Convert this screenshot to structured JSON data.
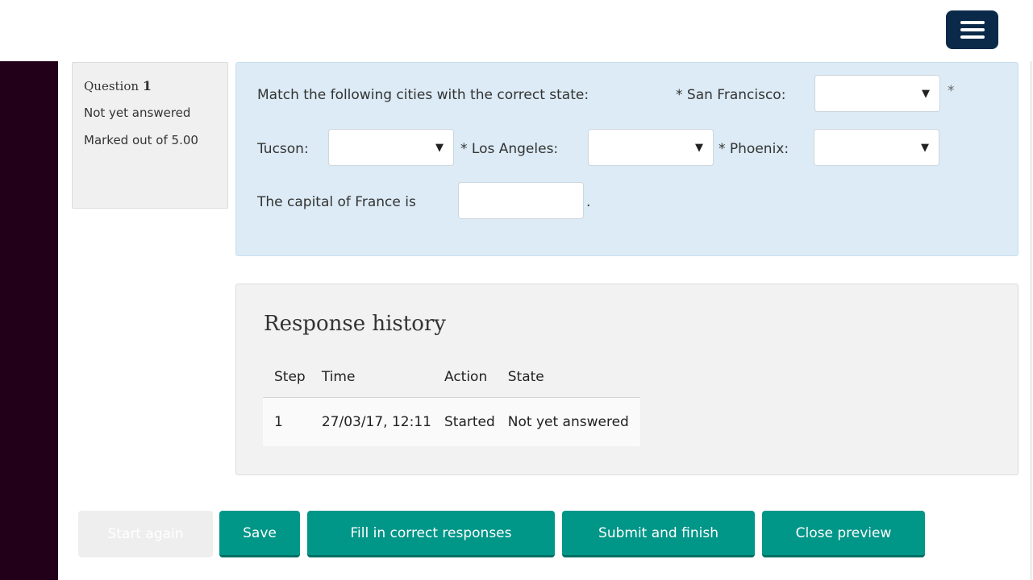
{
  "header": {
    "menu_icon": "hamburger-menu-icon"
  },
  "question_info": {
    "question_label": "Question",
    "question_number": "1",
    "status": "Not yet answered",
    "marked_out_of": "Marked out of 5.00"
  },
  "question": {
    "intro": "Match the following cities with the correct state:",
    "star": "*",
    "items": [
      {
        "label": "* San Francisco:",
        "selected": ""
      },
      {
        "label": "Tucson:",
        "selected": ""
      },
      {
        "label": "* Los Angeles:",
        "selected": ""
      },
      {
        "label": "* Phoenix:",
        "selected": ""
      }
    ],
    "caret": "▼",
    "fill_prefix": "The capital of France is",
    "fill_value": "",
    "fill_suffix": "."
  },
  "response_history": {
    "title": "Response history",
    "columns": [
      "Step",
      "Time",
      "Action",
      "State"
    ],
    "rows": [
      [
        "1",
        "27/03/17, 12:11",
        "Started",
        "Not yet answered"
      ]
    ]
  },
  "buttons": {
    "start_again": "Start again",
    "save": "Save",
    "fill_correct": "Fill in correct responses",
    "submit_finish": "Submit and finish",
    "close_preview": "Close preview"
  },
  "colors": {
    "accent": "#009688",
    "sidebar": "#22001a",
    "question_bg": "#dcebf5",
    "menu_button": "#0b2a4a"
  }
}
